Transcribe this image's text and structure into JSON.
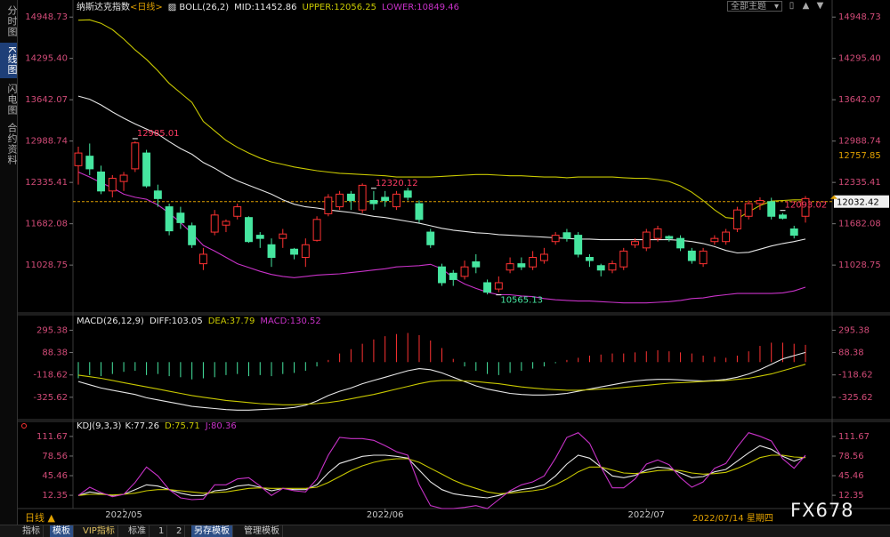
{
  "sidebar": {
    "tabs": [
      "分时图",
      "K线图",
      "闪电图",
      "合约资料"
    ],
    "active": 1
  },
  "toolbar": {
    "theme_select": "全部主题",
    "dropdown_icon": "chevron-down-icon"
  },
  "colors": {
    "up": "#ff3232",
    "down": "#46e6a0",
    "mid": "#e6e6e6",
    "upper": "#c8c800",
    "lower": "#c832c8",
    "axis_label": "#d24b78",
    "dif": "#e6e6e6",
    "dea": "#c8c800",
    "macd_label": "#c832c8",
    "k": "#e6e6e6",
    "d": "#c8c800",
    "j": "#c832c8"
  },
  "chart_data": [
    {
      "type": "candlestick",
      "title": "纳斯达克指数",
      "period_label": "<日线>",
      "indicator": "BOLL(26,2)",
      "indicator_values": {
        "MID": "11452.86",
        "UPPER": "12056.25",
        "LOWER": "10849.46"
      },
      "y_ticks": [
        "14948.73",
        "14295.40",
        "13642.07",
        "12988.74",
        "12335.41",
        "11682.08",
        "11028.75"
      ],
      "ylim": [
        10300,
        15050
      ],
      "extra_right_label": "12757.85",
      "last_price": "12032.42",
      "annotations": [
        {
          "text": "12985.01",
          "index": 5,
          "at": "high"
        },
        {
          "text": "12320.12",
          "index": 26,
          "at": "high"
        },
        {
          "text": "10565.13",
          "index": 37,
          "at": "low"
        },
        {
          "text": "12093.02",
          "index": 62,
          "at": "high"
        }
      ],
      "candles": [
        [
          12600,
          12800,
          12300,
          12900
        ],
        [
          12750,
          12550,
          12450,
          12950
        ],
        [
          12500,
          12200,
          12150,
          12600
        ],
        [
          12200,
          12400,
          12100,
          12450
        ],
        [
          12350,
          12450,
          12200,
          12500
        ],
        [
          12550,
          12960,
          12500,
          12985.01
        ],
        [
          12800,
          12280,
          12250,
          12850
        ],
        [
          12200,
          12080,
          11950,
          12300
        ],
        [
          11950,
          11570,
          11500,
          12000
        ],
        [
          11850,
          11700,
          11600,
          11950
        ],
        [
          11650,
          11350,
          11300,
          11700
        ],
        [
          11050,
          11200,
          10950,
          11300
        ],
        [
          11550,
          11820,
          11500,
          11900
        ],
        [
          11660,
          11720,
          11550,
          11750
        ],
        [
          11800,
          11950,
          11750,
          12000
        ],
        [
          11780,
          11400,
          11380,
          11800
        ],
        [
          11500,
          11450,
          11300,
          11550
        ],
        [
          11350,
          11150,
          11000,
          11450
        ],
        [
          11450,
          11520,
          11300,
          11600
        ],
        [
          11280,
          11200,
          11120,
          11300
        ],
        [
          11150,
          11350,
          11000,
          11450
        ],
        [
          11420,
          11750,
          11400,
          11800
        ],
        [
          11840,
          12100,
          11800,
          12150
        ],
        [
          11950,
          12150,
          11900,
          12200
        ],
        [
          12150,
          12050,
          11900,
          12200
        ],
        [
          11900,
          12290,
          11850,
          12320.12
        ],
        [
          12050,
          12000,
          11900,
          12200
        ],
        [
          12100,
          12050,
          11950,
          12200
        ],
        [
          11950,
          12150,
          11900,
          12200
        ],
        [
          12200,
          12100,
          12050,
          12250
        ],
        [
          12000,
          11750,
          11700,
          12050
        ],
        [
          11550,
          11350,
          11300,
          11600
        ],
        [
          11000,
          10750,
          10700,
          11050
        ],
        [
          10900,
          10800,
          10700,
          10950
        ],
        [
          10850,
          11000,
          10800,
          11100
        ],
        [
          11080,
          11000,
          10900,
          11200
        ],
        [
          10750,
          10600,
          10565.13,
          10800
        ],
        [
          10650,
          10750,
          10600,
          10850
        ],
        [
          10950,
          11050,
          10900,
          11150
        ],
        [
          11050,
          11000,
          10950,
          11150
        ],
        [
          11000,
          11150,
          10950,
          11250
        ],
        [
          11100,
          11200,
          11050,
          11300
        ],
        [
          11400,
          11500,
          11350,
          11550
        ],
        [
          11540,
          11450,
          11400,
          11600
        ],
        [
          11500,
          11200,
          11150,
          11550
        ],
        [
          11150,
          11100,
          11000,
          11200
        ],
        [
          11020,
          10950,
          10850,
          11050
        ],
        [
          10950,
          11050,
          10900,
          11100
        ],
        [
          11000,
          11250,
          10950,
          11300
        ],
        [
          11350,
          11400,
          11300,
          11450
        ],
        [
          11300,
          11550,
          11250,
          11600
        ],
        [
          11450,
          11600,
          11400,
          11650
        ],
        [
          11480,
          11450,
          11400,
          11500
        ],
        [
          11450,
          11300,
          11250,
          11500
        ],
        [
          11250,
          11100,
          11050,
          11300
        ],
        [
          11050,
          11250,
          11000,
          11300
        ],
        [
          11400,
          11450,
          11350,
          11500
        ],
        [
          11400,
          11550,
          11350,
          11600
        ],
        [
          11600,
          11900,
          11550,
          11950
        ],
        [
          11800,
          12000,
          11750,
          12050
        ],
        [
          12000,
          12050,
          11900,
          12100
        ],
        [
          12030,
          11800,
          11750,
          12093.02
        ],
        [
          11820,
          11770,
          11750,
          11850
        ],
        [
          11600,
          11500,
          11450,
          11650
        ],
        [
          11800,
          12080,
          11700,
          12120
        ]
      ],
      "upper_band": [
        14900,
        14905,
        14850,
        14750,
        14600,
        14430,
        14280,
        14100,
        13900,
        13750,
        13600,
        13300,
        13150,
        13000,
        12890,
        12800,
        12720,
        12660,
        12620,
        12580,
        12550,
        12520,
        12500,
        12480,
        12470,
        12460,
        12450,
        12440,
        12420,
        12420,
        12420,
        12420,
        12430,
        12440,
        12450,
        12460,
        12460,
        12450,
        12440,
        12440,
        12430,
        12420,
        12420,
        12410,
        12420,
        12420,
        12420,
        12420,
        12410,
        12400,
        12400,
        12380,
        12350,
        12280,
        12180,
        12050,
        11900,
        11780,
        11760,
        11870,
        11970,
        12040,
        12050,
        12060,
        12060
      ],
      "mid_band": [
        13700,
        13650,
        13560,
        13450,
        13350,
        13260,
        13180,
        13100,
        12980,
        12870,
        12780,
        12650,
        12560,
        12450,
        12360,
        12290,
        12220,
        12150,
        12060,
        11990,
        11950,
        11930,
        11900,
        11880,
        11860,
        11830,
        11800,
        11780,
        11750,
        11720,
        11690,
        11650,
        11610,
        11580,
        11560,
        11540,
        11530,
        11510,
        11500,
        11490,
        11480,
        11470,
        11460,
        11450,
        11440,
        11440,
        11430,
        11430,
        11430,
        11430,
        11430,
        11430,
        11430,
        11420,
        11400,
        11370,
        11320,
        11260,
        11220,
        11230,
        11280,
        11330,
        11370,
        11400,
        11440
      ],
      "lower_band": [
        12500,
        12420,
        12330,
        12250,
        12150,
        12100,
        12070,
        11980,
        11850,
        11700,
        11530,
        11340,
        11250,
        11150,
        11050,
        10990,
        10930,
        10880,
        10850,
        10830,
        10850,
        10870,
        10880,
        10890,
        10910,
        10930,
        10950,
        10970,
        11000,
        11010,
        11020,
        11040,
        10970,
        10830,
        10730,
        10660,
        10600,
        10560,
        10560,
        10540,
        10530,
        10500,
        10480,
        10470,
        10460,
        10460,
        10450,
        10440,
        10430,
        10430,
        10430,
        10440,
        10450,
        10470,
        10500,
        10510,
        10540,
        10560,
        10580,
        10580,
        10580,
        10580,
        10590,
        10620,
        10680
      ]
    },
    {
      "type": "macd",
      "indicator": "MACD(26,12,9)",
      "indicator_values": {
        "DIFF": "103.05",
        "DEA": "37.79",
        "MACD": "130.52"
      },
      "y_ticks": [
        "295.38",
        "88.38",
        "-118.62",
        "-325.62"
      ],
      "ylim": [
        -500,
        340
      ],
      "hist": [
        -150,
        -120,
        -130,
        -110,
        -90,
        -80,
        -120,
        -110,
        -130,
        -140,
        -160,
        -150,
        -140,
        -120,
        -110,
        -130,
        -120,
        -130,
        -110,
        -100,
        -80,
        -40,
        20,
        80,
        120,
        170,
        210,
        240,
        260,
        270,
        250,
        200,
        130,
        30,
        -40,
        -80,
        -110,
        -120,
        -100,
        -80,
        -60,
        -40,
        -10,
        20,
        40,
        60,
        70,
        80,
        80,
        90,
        100,
        110,
        100,
        90,
        80,
        60,
        50,
        40,
        60,
        100,
        150,
        180,
        180,
        170,
        160
      ],
      "dif": [
        -180,
        -210,
        -240,
        -260,
        -280,
        -300,
        -330,
        -350,
        -370,
        -390,
        -410,
        -420,
        -430,
        -440,
        -445,
        -445,
        -440,
        -435,
        -430,
        -420,
        -400,
        -360,
        -310,
        -270,
        -240,
        -200,
        -170,
        -140,
        -110,
        -80,
        -60,
        -70,
        -100,
        -140,
        -180,
        -220,
        -250,
        -270,
        -290,
        -300,
        -305,
        -305,
        -300,
        -290,
        -270,
        -250,
        -230,
        -210,
        -190,
        -175,
        -165,
        -160,
        -160,
        -165,
        -170,
        -175,
        -170,
        -160,
        -140,
        -110,
        -70,
        -20,
        30,
        60,
        90
      ],
      "dea": [
        -120,
        -135,
        -150,
        -170,
        -190,
        -210,
        -230,
        -250,
        -270,
        -290,
        -310,
        -325,
        -340,
        -355,
        -365,
        -375,
        -385,
        -390,
        -395,
        -395,
        -390,
        -385,
        -375,
        -360,
        -340,
        -320,
        -300,
        -275,
        -250,
        -225,
        -200,
        -180,
        -170,
        -170,
        -175,
        -180,
        -190,
        -200,
        -215,
        -230,
        -240,
        -250,
        -255,
        -260,
        -260,
        -255,
        -250,
        -245,
        -235,
        -225,
        -215,
        -205,
        -195,
        -190,
        -185,
        -180,
        -175,
        -170,
        -160,
        -150,
        -130,
        -110,
        -80,
        -50,
        -20
      ]
    },
    {
      "type": "kdj",
      "indicator": "KDJ(9,3,3)",
      "indicator_values": {
        "K": "77.26",
        "D": "75.71",
        "J": "80.36"
      },
      "y_ticks": [
        "111.67",
        "78.56",
        "45.46",
        "12.35"
      ],
      "ylim": [
        -10,
        125
      ],
      "k": [
        12,
        18,
        15,
        12,
        14,
        22,
        30,
        28,
        22,
        16,
        12,
        12,
        20,
        22,
        28,
        30,
        26,
        20,
        24,
        22,
        22,
        30,
        50,
        66,
        72,
        78,
        80,
        80,
        78,
        75,
        55,
        35,
        22,
        15,
        12,
        10,
        8,
        12,
        18,
        22,
        25,
        30,
        45,
        65,
        80,
        75,
        60,
        45,
        42,
        46,
        55,
        60,
        58,
        50,
        42,
        44,
        52,
        56,
        70,
        84,
        96,
        90,
        78,
        70,
        77
      ],
      "d": [
        12,
        14,
        14,
        13,
        14,
        16,
        20,
        22,
        22,
        20,
        18,
        16,
        17,
        18,
        21,
        24,
        25,
        24,
        24,
        24,
        24,
        26,
        34,
        44,
        54,
        62,
        68,
        72,
        74,
        74,
        68,
        58,
        48,
        38,
        30,
        24,
        18,
        15,
        16,
        18,
        20,
        23,
        30,
        40,
        52,
        60,
        60,
        55,
        50,
        49,
        51,
        54,
        55,
        54,
        50,
        48,
        49,
        51,
        58,
        66,
        76,
        80,
        80,
        77,
        76
      ],
      "j": [
        12,
        26,
        17,
        10,
        14,
        34,
        60,
        45,
        22,
        8,
        5,
        6,
        30,
        30,
        40,
        42,
        28,
        12,
        24,
        20,
        18,
        40,
        80,
        110,
        108,
        108,
        105,
        96,
        86,
        80,
        30,
        -5,
        -10,
        -10,
        -8,
        -5,
        -10,
        5,
        20,
        30,
        35,
        45,
        75,
        110,
        118,
        100,
        60,
        25,
        25,
        40,
        65,
        72,
        64,
        42,
        26,
        35,
        58,
        66,
        94,
        118,
        112,
        104,
        74,
        58,
        80
      ]
    }
  ],
  "x_axis": {
    "labels": [
      {
        "text": "2022/05",
        "index": 4
      },
      {
        "text": "2022/06",
        "index": 27
      },
      {
        "text": "2022/07",
        "index": 50
      }
    ]
  },
  "footer": {
    "period_button": "日线 ▲",
    "date_readout": "2022/07/14 星期四",
    "tabs": [
      "指标",
      "模板",
      "VIP指标",
      "标准",
      "1",
      "2",
      "另存模板",
      "管理模板"
    ],
    "active_tab": 1,
    "watermark": "FX678"
  }
}
